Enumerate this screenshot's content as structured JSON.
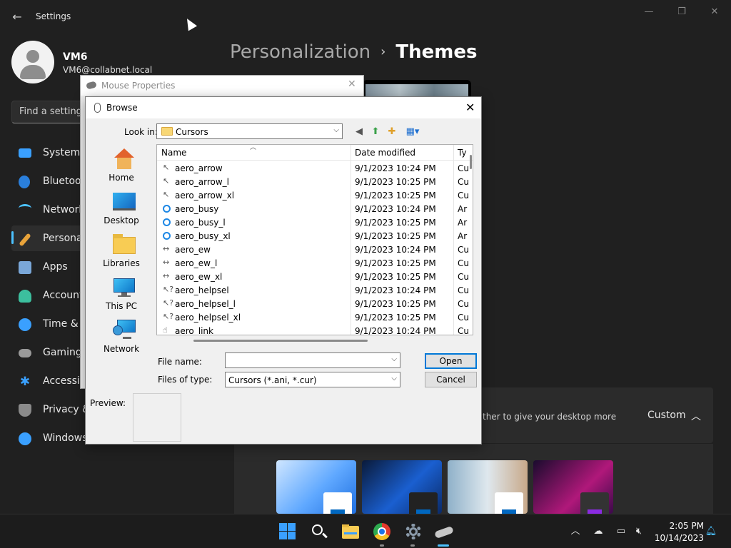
{
  "settings": {
    "window_title": "Settings",
    "user": {
      "name": "VM6",
      "email": "VM6@collabnet.local"
    },
    "search_placeholder": "Find a setting",
    "nav": [
      {
        "label": "System",
        "icon": "monitor-icon",
        "color": "#3aa0ff"
      },
      {
        "label": "Bluetooth & devices",
        "icon": "bluetooth-icon",
        "color": "#2a7fdc"
      },
      {
        "label": "Network & internet",
        "icon": "wifi-icon",
        "color": "#4cc2ff"
      },
      {
        "label": "Personalization",
        "icon": "brush-icon",
        "color": "#e8a33a"
      },
      {
        "label": "Apps",
        "icon": "apps-icon",
        "color": "#7aa7d8"
      },
      {
        "label": "Accounts",
        "icon": "person-icon",
        "color": "#3cbf9e"
      },
      {
        "label": "Time & language",
        "icon": "globe-clock-icon",
        "color": "#3aa0ff"
      },
      {
        "label": "Gaming",
        "icon": "gamepad-icon",
        "color": "#9a9a9a"
      },
      {
        "label": "Accessibility",
        "icon": "accessibility-icon",
        "color": "#3aa0ff"
      },
      {
        "label": "Privacy & security",
        "icon": "shield-icon",
        "color": "#8a8a8a"
      },
      {
        "label": "Windows Update",
        "icon": "update-icon",
        "color": "#3aa0ff"
      }
    ],
    "breadcrumb": {
      "parent": "Personalization",
      "separator": "›",
      "current": "Themes"
    },
    "custom_theme": {
      "description": "ther to give your desktop more",
      "value": "Custom"
    }
  },
  "mouse_properties": {
    "title": "Mouse Properties"
  },
  "browse": {
    "title": "Browse",
    "look_in_label": "Look in:",
    "look_in_value": "Cursors",
    "places": [
      {
        "label": "Home",
        "icon": "home-icon"
      },
      {
        "label": "Desktop",
        "icon": "desktop-icon"
      },
      {
        "label": "Libraries",
        "icon": "libraries-icon"
      },
      {
        "label": "This PC",
        "icon": "this-pc-icon"
      },
      {
        "label": "Network",
        "icon": "network-icon"
      }
    ],
    "columns": [
      "Name",
      "Date modified",
      "Ty"
    ],
    "files": [
      {
        "name": "aero_arrow",
        "date": "9/1/2023 10:24 PM",
        "type": "Cu",
        "icon": "arrow"
      },
      {
        "name": "aero_arrow_l",
        "date": "9/1/2023 10:25 PM",
        "type": "Cu",
        "icon": "arrow"
      },
      {
        "name": "aero_arrow_xl",
        "date": "9/1/2023 10:25 PM",
        "type": "Cu",
        "icon": "arrow"
      },
      {
        "name": "aero_busy",
        "date": "9/1/2023 10:24 PM",
        "type": "Ar",
        "icon": "busy"
      },
      {
        "name": "aero_busy_l",
        "date": "9/1/2023 10:25 PM",
        "type": "Ar",
        "icon": "busy"
      },
      {
        "name": "aero_busy_xl",
        "date": "9/1/2023 10:25 PM",
        "type": "Ar",
        "icon": "busy"
      },
      {
        "name": "aero_ew",
        "date": "9/1/2023 10:24 PM",
        "type": "Cu",
        "icon": "ew"
      },
      {
        "name": "aero_ew_l",
        "date": "9/1/2023 10:25 PM",
        "type": "Cu",
        "icon": "ew"
      },
      {
        "name": "aero_ew_xl",
        "date": "9/1/2023 10:25 PM",
        "type": "Cu",
        "icon": "ew"
      },
      {
        "name": "aero_helpsel",
        "date": "9/1/2023 10:24 PM",
        "type": "Cu",
        "icon": "help"
      },
      {
        "name": "aero_helpsel_l",
        "date": "9/1/2023 10:25 PM",
        "type": "Cu",
        "icon": "help"
      },
      {
        "name": "aero_helpsel_xl",
        "date": "9/1/2023 10:25 PM",
        "type": "Cu",
        "icon": "help"
      },
      {
        "name": "aero_link",
        "date": "9/1/2023 10:24 PM",
        "type": "Cu",
        "icon": "link"
      }
    ],
    "file_name_label": "File name:",
    "file_name_value": "",
    "files_of_type_label": "Files of type:",
    "files_of_type_value": "Cursors (*.ani, *.cur)",
    "open_label": "Open",
    "cancel_label": "Cancel",
    "preview_label": "Preview:"
  },
  "taskbar": {
    "apps": [
      "start-icon",
      "search-icon",
      "file-explorer-icon",
      "chrome-icon",
      "settings-icon",
      "mouse-properties-icon"
    ],
    "time": "2:05 PM",
    "date": "10/14/2023"
  }
}
